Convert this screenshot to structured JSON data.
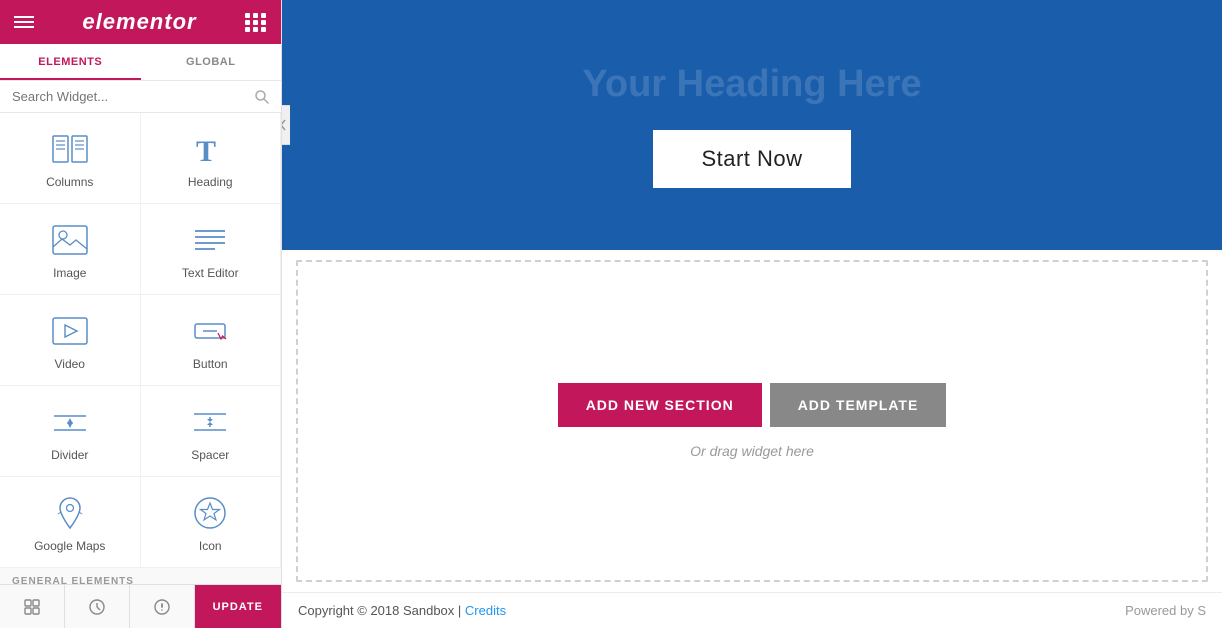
{
  "sidebar": {
    "logo": "elementor",
    "tabs": [
      {
        "id": "elements",
        "label": "ELEMENTS",
        "active": true
      },
      {
        "id": "global",
        "label": "GLOBAL",
        "active": false
      }
    ],
    "search": {
      "placeholder": "Search Widget...",
      "value": ""
    },
    "widgets": [
      {
        "id": "columns",
        "label": "Columns",
        "icon": "columns-icon"
      },
      {
        "id": "heading",
        "label": "Heading",
        "icon": "heading-icon"
      },
      {
        "id": "image",
        "label": "Image",
        "icon": "image-icon"
      },
      {
        "id": "text-editor",
        "label": "Text Editor",
        "icon": "text-editor-icon"
      },
      {
        "id": "video",
        "label": "Video",
        "icon": "video-icon"
      },
      {
        "id": "button",
        "label": "Button",
        "icon": "button-icon"
      },
      {
        "id": "divider",
        "label": "Divider",
        "icon": "divider-icon"
      },
      {
        "id": "spacer",
        "label": "Spacer",
        "icon": "spacer-icon"
      },
      {
        "id": "google-maps",
        "label": "Google Maps",
        "icon": "google-maps-icon"
      },
      {
        "id": "icon",
        "label": "Icon",
        "icon": "icon-icon"
      }
    ],
    "section_label": "GENERAL ELEMENTS",
    "footer": {
      "update_label": "UPDATE"
    }
  },
  "hero": {
    "title": "Start Now",
    "background_color": "#1a5dab"
  },
  "canvas": {
    "add_new_section_label": "ADD NEW SECTION",
    "add_template_label": "ADD TEMPLATE",
    "drag_hint": "Or drag widget here"
  },
  "footer": {
    "copyright": "Copyright © 2018 Sandbox | ",
    "credits_label": "Credits",
    "powered_by": "Powered by S"
  }
}
